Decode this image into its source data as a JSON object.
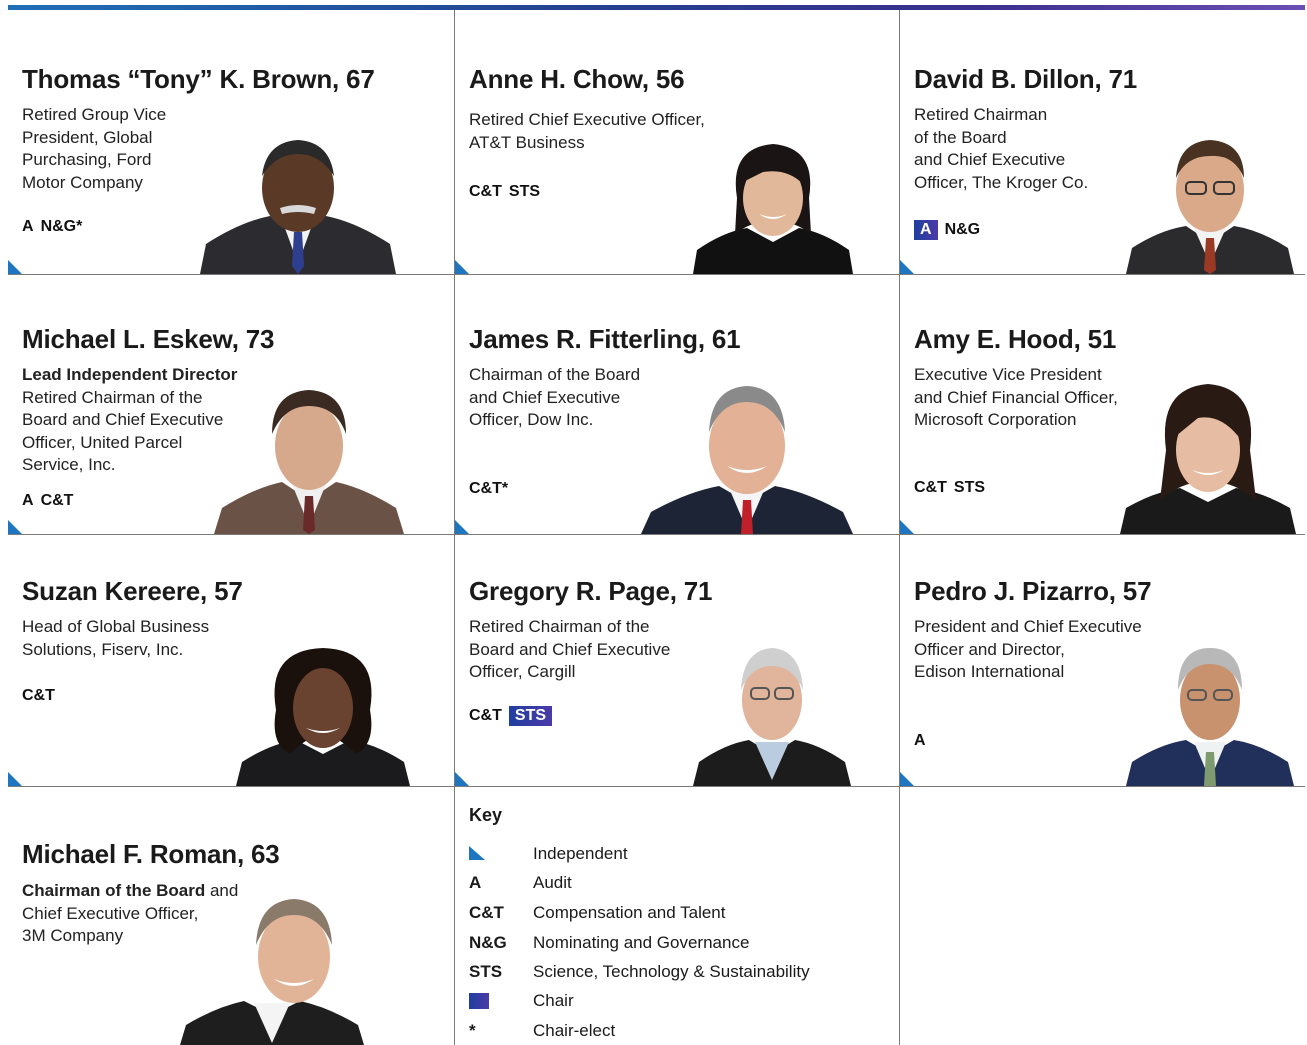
{
  "directors": [
    {
      "name": "Thomas “Tony” K. Brown, 67",
      "role_lines": [
        "Retired Group Vice",
        "President, Global",
        "Purchasing, Ford",
        "Motor Company"
      ],
      "committees": [
        {
          "t": "A",
          "chair": false
        },
        {
          "t": "N&G*",
          "chair": false
        }
      ]
    },
    {
      "name": "Anne H. Chow, 56",
      "role_lines": [
        "Retired Chief Executive Officer,",
        "AT&T Business"
      ],
      "committees": [
        {
          "t": "C&T",
          "chair": false
        },
        {
          "t": "STS",
          "chair": false
        }
      ]
    },
    {
      "name": "David B. Dillon, 71",
      "role_lines": [
        "Retired Chairman",
        "of the Board",
        "and Chief Executive",
        "Officer, The Kroger Co."
      ],
      "committees": [
        {
          "t": "A",
          "chair": true
        },
        {
          "t": "N&G",
          "chair": false
        }
      ]
    },
    {
      "name": "Michael L. Eskew, 73",
      "role_bold": "Lead Independent Director",
      "role_lines": [
        "Retired Chairman of the",
        "Board and Chief Executive",
        "Officer, United Parcel",
        "Service, Inc."
      ],
      "committees": [
        {
          "t": "A",
          "chair": false
        },
        {
          "t": "C&T",
          "chair": false
        }
      ]
    },
    {
      "name": "James R. Fitterling, 61",
      "role_lines": [
        "Chairman of the Board",
        "and Chief Executive",
        "Officer, Dow Inc."
      ],
      "committees": [
        {
          "t": "C&T*",
          "chair": false
        }
      ]
    },
    {
      "name": "Amy E. Hood, 51",
      "role_lines": [
        "Executive Vice President",
        "and Chief Financial Officer,",
        "Microsoft Corporation"
      ],
      "committees": [
        {
          "t": "C&T",
          "chair": false
        },
        {
          "t": "STS",
          "chair": false
        }
      ]
    },
    {
      "name": "Suzan Kereere, 57",
      "role_lines": [
        "Head of Global Business",
        "Solutions, Fiserv, Inc."
      ],
      "committees": [
        {
          "t": "C&T",
          "chair": false
        }
      ]
    },
    {
      "name": "Gregory R. Page, 71",
      "role_lines": [
        "Retired Chairman of the",
        "Board and Chief Executive",
        "Officer, Cargill"
      ],
      "committees": [
        {
          "t": "C&T",
          "chair": false
        },
        {
          "t": "STS",
          "chair": true
        }
      ]
    },
    {
      "name": "Pedro J. Pizarro, 57",
      "role_lines": [
        "President and Chief Executive",
        "Officer and Director,",
        "Edison International"
      ],
      "committees": [
        {
          "t": "A",
          "chair": false
        }
      ]
    },
    {
      "name": "Michael F. Roman, 63",
      "role_first_bold": "Chairman of the Board",
      "role_first_rest": " and",
      "role_lines": [
        "Chief Executive Officer,",
        "3M Company"
      ],
      "committees": []
    }
  ],
  "key": {
    "title": "Key",
    "items": [
      {
        "abbr": "",
        "label": "Independent",
        "icon": "independent-triangle"
      },
      {
        "abbr": "A",
        "label": "Audit"
      },
      {
        "abbr": "C&T",
        "label": "Compensation and Talent"
      },
      {
        "abbr": "N&G",
        "label": "Nominating and Governance"
      },
      {
        "abbr": "STS",
        "label": "Science, Technology & Sustainability"
      },
      {
        "abbr": "",
        "label": "Chair",
        "icon": "chair-square"
      },
      {
        "abbr": "*",
        "label": "Chair-elect"
      }
    ]
  },
  "colors": {
    "accent": "#1f76c0",
    "chair_start": "#1f3f9f",
    "chair_end": "#4b3aa8"
  }
}
